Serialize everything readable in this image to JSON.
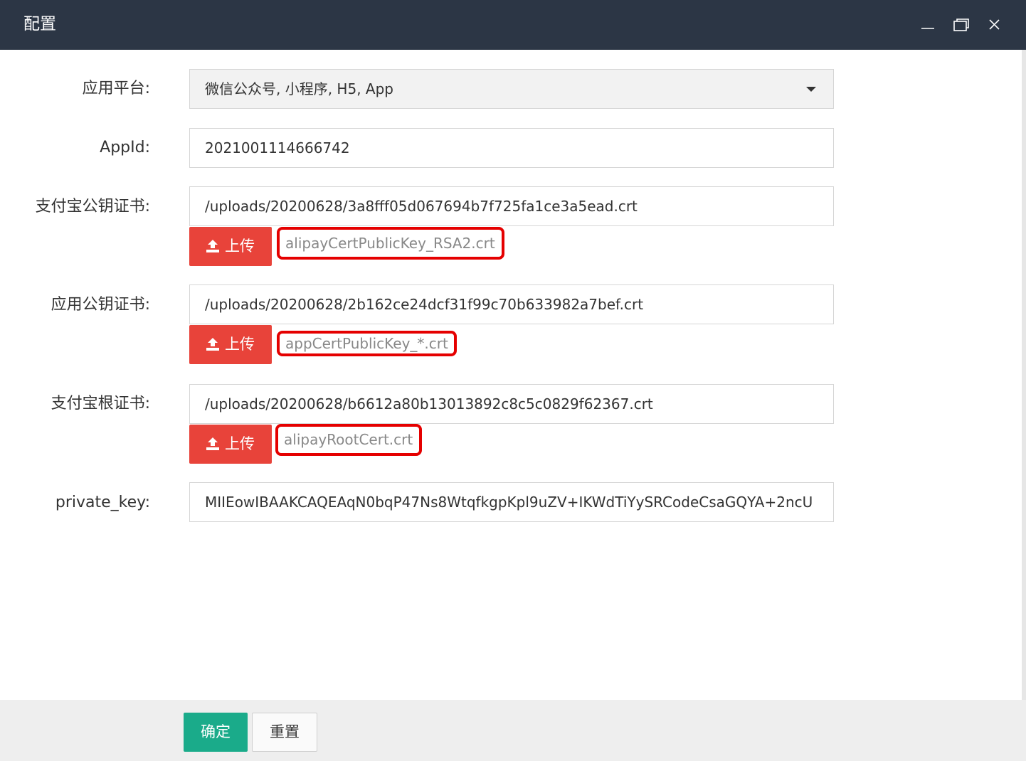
{
  "window": {
    "title": "配置",
    "controls": [
      "minimize-icon",
      "maximize-icon",
      "close-icon"
    ]
  },
  "form": {
    "platform": {
      "label": "应用平台:",
      "value": "微信公众号, 小程序, H5, App"
    },
    "appid": {
      "label": "AppId:",
      "value": "2021001114666742"
    },
    "alipay_public_cert": {
      "label": "支付宝公钥证书:",
      "value": "/uploads/20200628/3a8fff05d067694b7f725fa1ce3a5ead.crt",
      "upload_label": "上传",
      "hint": "alipayCertPublicKey_RSA2.crt"
    },
    "app_public_cert": {
      "label": "应用公钥证书:",
      "value": "/uploads/20200628/2b162ce24dcf31f99c70b633982a7bef.crt",
      "upload_label": "上传",
      "hint": "appCertPublicKey_*.crt"
    },
    "alipay_root_cert": {
      "label": "支付宝根证书:",
      "value": "/uploads/20200628/b6612a80b13013892c8c5c0829f62367.crt",
      "upload_label": "上传",
      "hint": "alipayRootCert.crt"
    },
    "private_key": {
      "label": "private_key:",
      "value": "MIIEowIBAAKCAQEAqN0bqP47Ns8WtqfkgpKpl9uZV+IKWdTiYySRCodeCsaGQYA+2ncU"
    }
  },
  "footer": {
    "submit_label": "确定",
    "reset_label": "重置"
  },
  "colors": {
    "titlebar": "#2c3645",
    "upload_button": "#e8433a",
    "submit_button": "#1aab8a",
    "hint_border": "#e50000"
  }
}
